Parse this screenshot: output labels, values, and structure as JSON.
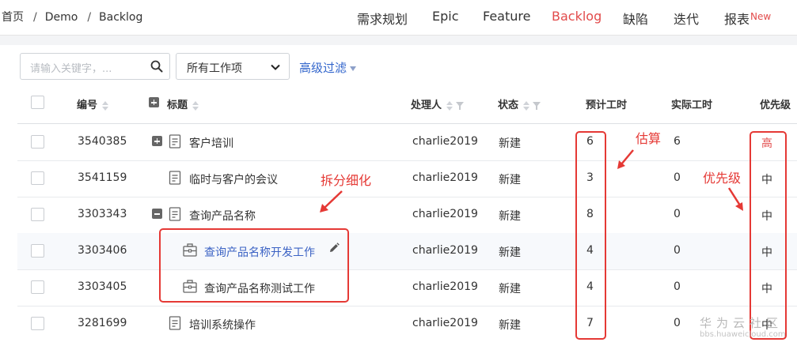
{
  "breadcrumb": [
    "首页",
    "Demo",
    "Backlog"
  ],
  "breadcrumb_sep": "/",
  "nav": {
    "items": [
      "需求规划",
      "Epic",
      "Feature",
      "Backlog",
      "缺陷",
      "迭代",
      "报表"
    ],
    "active": "Backlog",
    "new_badge": "New"
  },
  "toolbar": {
    "search_placeholder": "请输入关键字，...",
    "filter_select": "所有工作项",
    "advanced_filter": "高级过滤"
  },
  "columns": {
    "id": "编号",
    "title": "标题",
    "assignee": "处理人",
    "status": "状态",
    "estimate": "预计工时",
    "actual": "实际工时",
    "priority": "优先级"
  },
  "rows": [
    {
      "id": "3540385",
      "title": "客户培训",
      "assignee": "charlie2019",
      "status": "新建",
      "estimate": "6",
      "actual": "6",
      "priority": "高"
    },
    {
      "id": "3541159",
      "title": "临时与客户的会议",
      "assignee": "charlie2019",
      "status": "新建",
      "estimate": "3",
      "actual": "0",
      "priority": "中"
    },
    {
      "id": "3303343",
      "title": "查询产品名称",
      "assignee": "charlie2019",
      "status": "新建",
      "estimate": "8",
      "actual": "0",
      "priority": "中"
    },
    {
      "id": "3303406",
      "title": "查询产品名称开发工作",
      "assignee": "charlie2019",
      "status": "新建",
      "estimate": "4",
      "actual": "0",
      "priority": "中"
    },
    {
      "id": "3303405",
      "title": "查询产品名称测试工作",
      "assignee": "charlie2019",
      "status": "新建",
      "estimate": "4",
      "actual": "0",
      "priority": "中"
    },
    {
      "id": "3281699",
      "title": "培训系统操作",
      "assignee": "charlie2019",
      "status": "新建",
      "estimate": "7",
      "actual": "0",
      "priority": "中"
    }
  ],
  "annotations": {
    "split": "拆分细化",
    "estimate": "估算",
    "priority": "优先级"
  },
  "watermark": {
    "brand": "华为云社区",
    "url": "bbs.huaweicloud.com"
  },
  "colors": {
    "accent_red": "#e24b4b",
    "link_blue": "#3b62c4",
    "annotation_red": "#e53935"
  }
}
